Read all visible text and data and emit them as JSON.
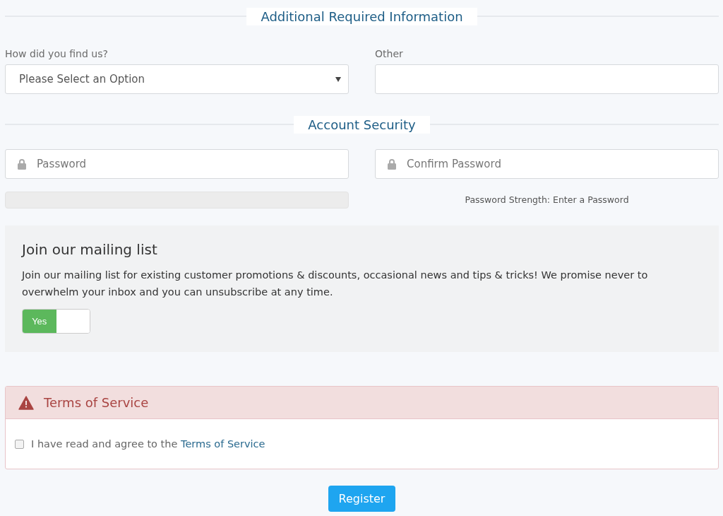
{
  "sections": [
    {
      "title": "Additional Required Information"
    },
    {
      "title": "Account Security"
    }
  ],
  "find_us": {
    "label": "How did you find us?",
    "value": "Please Select an Option"
  },
  "other": {
    "label": "Other"
  },
  "password": {
    "placeholder": "Password"
  },
  "confirm_password": {
    "placeholder": "Confirm Password"
  },
  "strength": {
    "level": 0,
    "text": "Password Strength: Enter a Password"
  },
  "mailing": {
    "title": "Join our mailing list",
    "text": "Join our mailing list for existing customer promotions & discounts, occasional news and tips & tricks! We promise never to overwhelm your inbox and you can unsubscribe at any time.",
    "toggle": {
      "label": "Yes",
      "on": true
    }
  },
  "terms": {
    "title": "Terms of Service",
    "checked": false,
    "text": "I have read and agree to the",
    "link": "Terms of Service"
  },
  "register": "Register"
}
